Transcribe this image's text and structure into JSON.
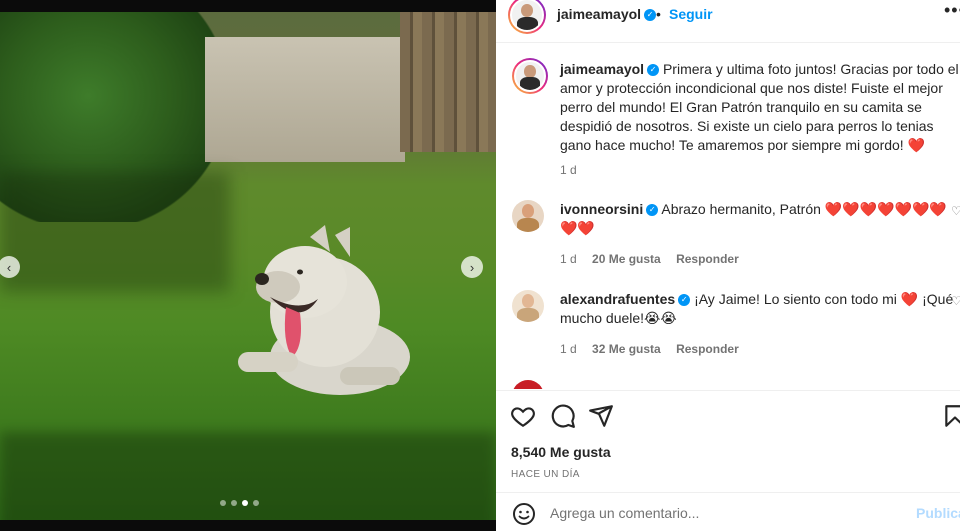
{
  "post": {
    "username": "jaimeamayol",
    "follow_label": "Seguir",
    "separator": "•",
    "more_label": "•••",
    "verified_glyph": "✓"
  },
  "caption": {
    "username": "jaimeamayol",
    "text": "Primera y ultima foto juntos! Gracias por todo el amor y protección incondicional que nos diste! Fuiste el mejor perro del mundo! El Gran Patrón tranquilo en su camita se despidió de nosotros. Si existe un cielo para perros lo tenias gano hace mucho! Te amaremos por siempre mi gordo!",
    "emoji": "❤️",
    "age": "1 d"
  },
  "comments": [
    {
      "username": "ivonneorsini",
      "verified": true,
      "text": "Abrazo hermanito, Patrón ❤️❤️❤️❤️❤️❤️❤️❤️❤️",
      "age": "1 d",
      "likes": "20 Me gusta",
      "reply": "Responder"
    },
    {
      "username": "alexandrafuentes",
      "verified": true,
      "text": "¡Ay Jaime! Lo siento con todo mi ❤️ ¡Qué mucho duele!😭😭",
      "age": "1 d",
      "likes": "32 Me gusta",
      "reply": "Responder"
    }
  ],
  "actions": {
    "like_icon": "heart-icon",
    "comment_icon": "comment-icon",
    "share_icon": "share-icon",
    "save_icon": "bookmark-icon",
    "likes": "8,540 Me gusta",
    "time": "HACE UN DÍA"
  },
  "composer": {
    "placeholder": "Agrega un comentario...",
    "publish_label": "Publicar"
  },
  "carousel": {
    "prev": "‹",
    "next": "›",
    "slides": 4,
    "active_slide": 3
  },
  "colors": {
    "accent": "#0095f6",
    "heart": "#e0102b",
    "muted": "#737373",
    "publish_disabled": "#b3dbff"
  }
}
